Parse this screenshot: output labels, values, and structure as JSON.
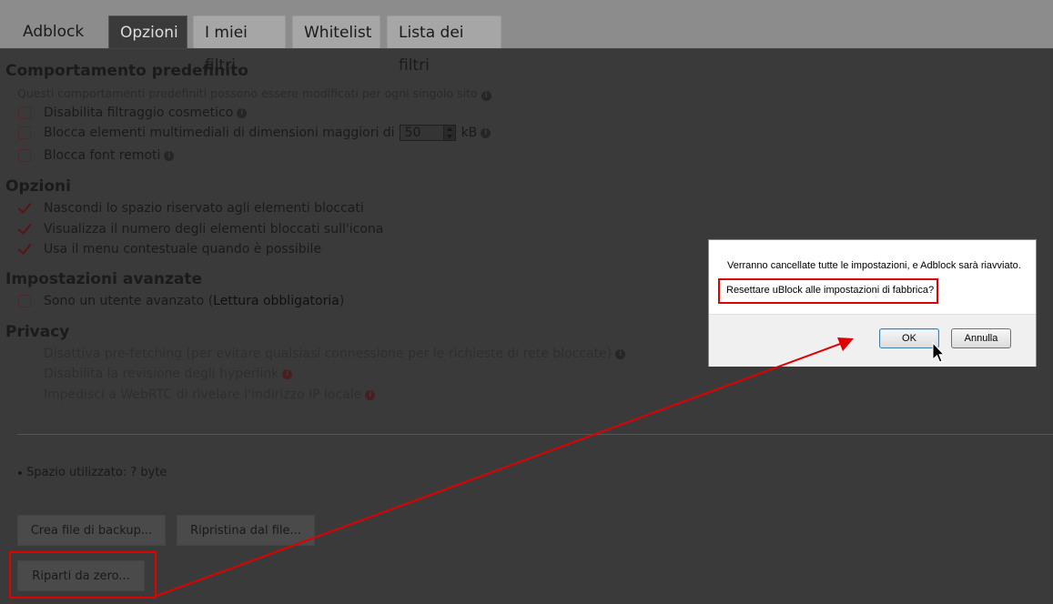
{
  "tabs": [
    {
      "label": "Adblock"
    },
    {
      "label": "Opzioni"
    },
    {
      "label": "I miei filtri"
    },
    {
      "label": "Whitelist"
    },
    {
      "label": "Lista dei filtri"
    }
  ],
  "default_behavior": {
    "title": "Comportamento predefinito",
    "note": "Questi comportamenti predefiniti possono essere modificati per ogni singolo sito",
    "disable_cosmetic": "Disabilita filtraggio cosmetico",
    "block_media_prefix": "Blocca elementi multimediali di dimensioni maggiori di",
    "block_media_value": "50",
    "block_media_unit": "kB",
    "block_fonts": "Blocca font remoti"
  },
  "options": {
    "title": "Opzioni",
    "hide_placeholders": "Nascondi lo spazio riservato agli elementi bloccati",
    "show_count": "Visualizza il numero degli elementi bloccati sull'icona",
    "context_menu": "Usa il menu contestuale quando è possibile"
  },
  "advanced": {
    "title": "Impostazioni avanzate",
    "advanced_user": "Sono un utente avanzato (",
    "required_reading": "Lettura obbligatoria",
    "advanced_user_close": ")"
  },
  "privacy": {
    "title": "Privacy",
    "prefetch": "Disattiva pre-fetching (per evitare qualsiasi connessione per le richieste di rete bloccate)",
    "hyperlink": "Disabilita la revisione degli hyperlink",
    "webrtc": "Impedisci a WebRTC di rivelare l'indirizzo IP locale"
  },
  "storage": {
    "used_label": "Spazio utilizzato: ? byte"
  },
  "buttons": {
    "backup": "Crea file di backup...",
    "restore": "Ripristina dal file...",
    "reset": "Riparti da zero..."
  },
  "dialog": {
    "message": "Verranno cancellate tutte le impostazioni, e Adblock sarà riavviato.",
    "question": "Resettare uBlock alle impostazioni di fabbrica?",
    "ok": "OK",
    "cancel": "Annulla"
  },
  "colors": {
    "annotation": "#e00000",
    "overlay_bg": "#3a3a3a",
    "tabbar_bg": "#8c8c8c"
  }
}
